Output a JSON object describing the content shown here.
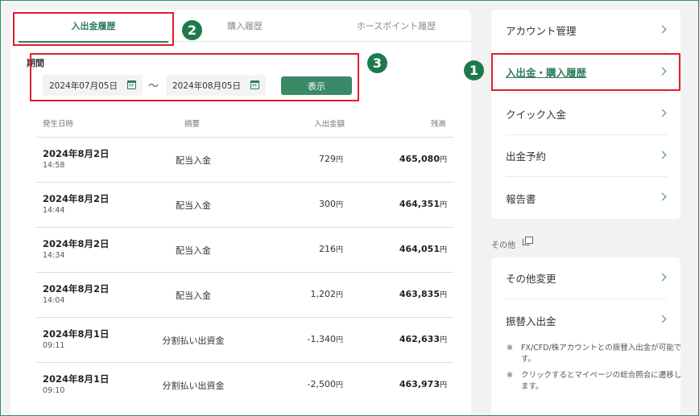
{
  "tabs": [
    "入出金履歴",
    "購入履歴",
    "ホースポイント履歴"
  ],
  "filter": {
    "period_label": "期間",
    "date_from": "2024年07月05日",
    "date_to": "2024年08月05日",
    "separator": "〜",
    "show_button": "表示"
  },
  "table": {
    "headers": [
      "発生日時",
      "摘要",
      "入出金額",
      "残高"
    ],
    "rows": [
      {
        "date": "2024年8月2日",
        "time": "14:58",
        "summary": "配当入金",
        "amount": "729",
        "balance": "465,080"
      },
      {
        "date": "2024年8月2日",
        "time": "14:44",
        "summary": "配当入金",
        "amount": "300",
        "balance": "464,351"
      },
      {
        "date": "2024年8月2日",
        "time": "14:34",
        "summary": "配当入金",
        "amount": "216",
        "balance": "464,051"
      },
      {
        "date": "2024年8月2日",
        "time": "14:04",
        "summary": "配当入金",
        "amount": "1,202",
        "balance": "463,835"
      },
      {
        "date": "2024年8月1日",
        "time": "09:11",
        "summary": "分割払い出資金",
        "amount": "-1,340",
        "balance": "462,633"
      },
      {
        "date": "2024年8月1日",
        "time": "09:10",
        "summary": "分割払い出資金",
        "amount": "-2,500",
        "balance": "463,973"
      }
    ],
    "currency": "円"
  },
  "sidebar": {
    "menu": [
      "アカウント管理",
      "入出金・購入履歴",
      "クイック入金",
      "出金予約",
      "報告書"
    ],
    "other_label": "その他",
    "other_menu": [
      "その他変更",
      "振替入出金"
    ],
    "notes": [
      {
        "mark": "※",
        "text": "FX/CFD/株アカウントとの振替入出金が可能です。"
      },
      {
        "mark": "※",
        "text": "クリックするとマイページの総合照会に遷移します。"
      }
    ]
  },
  "annotations": [
    "1",
    "2",
    "3"
  ],
  "colors": {
    "accent": "#2e7d5b",
    "highlight": "#e01e2b",
    "badge": "#1e7a4c"
  }
}
